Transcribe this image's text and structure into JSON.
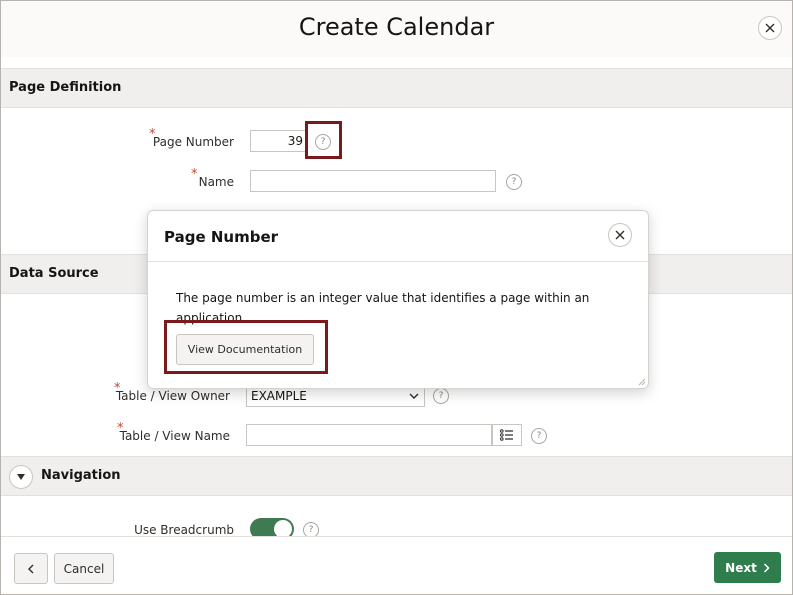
{
  "dialog": {
    "title": "Create Calendar"
  },
  "sections": {
    "page_definition": {
      "title": "Page Definition",
      "page_number": {
        "label": "Page Number",
        "value": "39"
      },
      "name": {
        "label": "Name",
        "value": ""
      }
    },
    "data_source": {
      "title": "Data Source",
      "table_view_owner": {
        "label": "Table / View Owner",
        "value": "EXAMPLE"
      },
      "table_view_name": {
        "label": "Table / View Name",
        "value": ""
      }
    },
    "navigation": {
      "title": "Navigation",
      "use_breadcrumb": {
        "label": "Use Breadcrumb",
        "enabled": true
      }
    }
  },
  "help_popup": {
    "title": "Page Number",
    "text": "The page number is an integer value that identifies a page within an application.",
    "button_label": "View Documentation"
  },
  "footer": {
    "cancel_label": "Cancel",
    "next_label": "Next"
  },
  "colors": {
    "accent_green": "#2f7d4c",
    "highlight": "#7a1a1a",
    "required": "#c74634"
  }
}
